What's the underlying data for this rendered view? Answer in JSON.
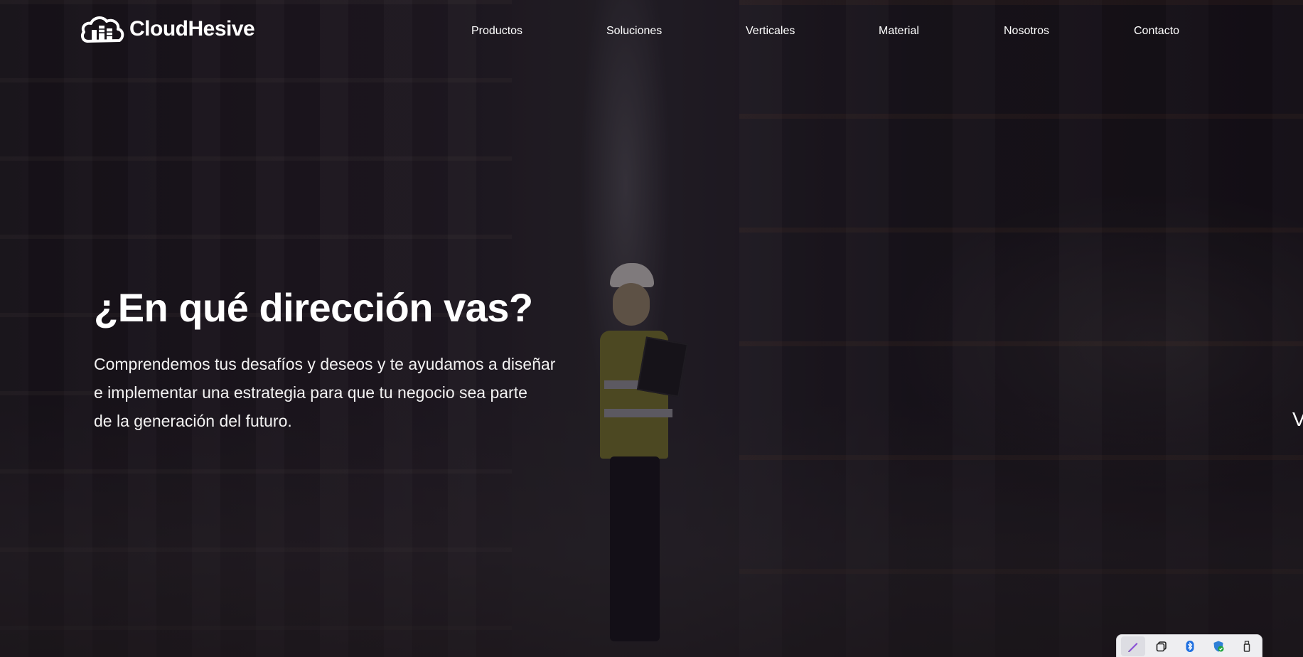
{
  "brand": {
    "name": "CloudHesive",
    "icon": "cloud-buildings-logo-icon"
  },
  "nav": {
    "items": [
      {
        "label": "Productos"
      },
      {
        "label": "Soluciones"
      },
      {
        "label": "Verticales"
      },
      {
        "label": "Material"
      },
      {
        "label": "Nosotros"
      },
      {
        "label": "Contacto"
      }
    ]
  },
  "hero": {
    "title": "¿En qué dirección vas?",
    "lines": [
      "Comprendemos tus desafíos y deseos y te ayudamos a diseñar",
      " e implementar una estrategia para que tu negocio sea parte",
      "de la generación del futuro."
    ],
    "edge_letter": "V"
  },
  "tray": {
    "icons": [
      "pen-icon",
      "copy-icon",
      "bluetooth-icon",
      "security-shield-icon",
      "usb-drive-icon"
    ]
  },
  "colors": {
    "text": "#ffffff",
    "background": "#131017",
    "tray": "#eeeef1",
    "bluetooth": "#1e6fe0",
    "pen": "#8a4fd6"
  }
}
